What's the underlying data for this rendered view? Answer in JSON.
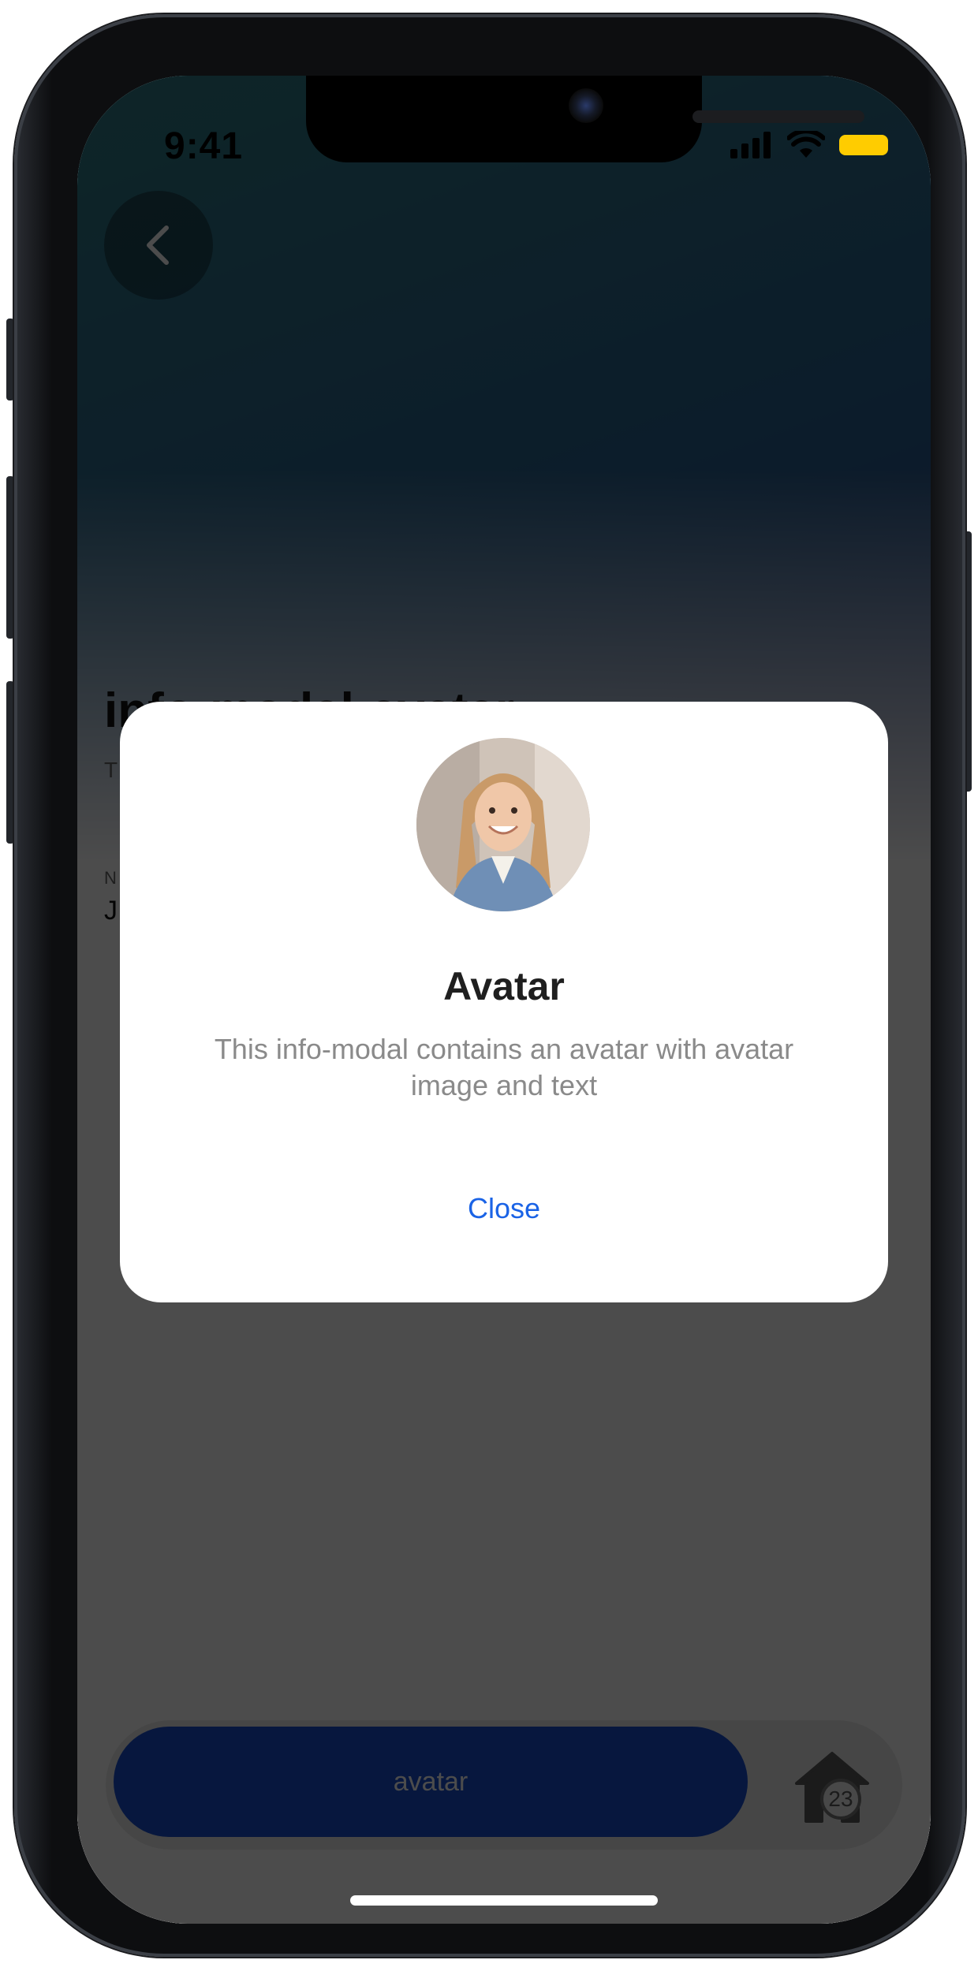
{
  "status_bar": {
    "time": "9:41",
    "battery_color": "#ffcc00"
  },
  "page": {
    "title": "info-modal-avatar",
    "subtitle": "T",
    "field_label": "N",
    "field_value": "J",
    "back_icon": "chevron-left-icon"
  },
  "modal": {
    "avatar_alt": "avatar image",
    "title": "Avatar",
    "text": "This info-modal contains an avatar with avatar image and text",
    "close_label": "Close"
  },
  "bottom_bar": {
    "primary_label": "avatar",
    "primary_color": "#1a4fd0",
    "home_icon": "home-icon",
    "badge_count": "23"
  }
}
